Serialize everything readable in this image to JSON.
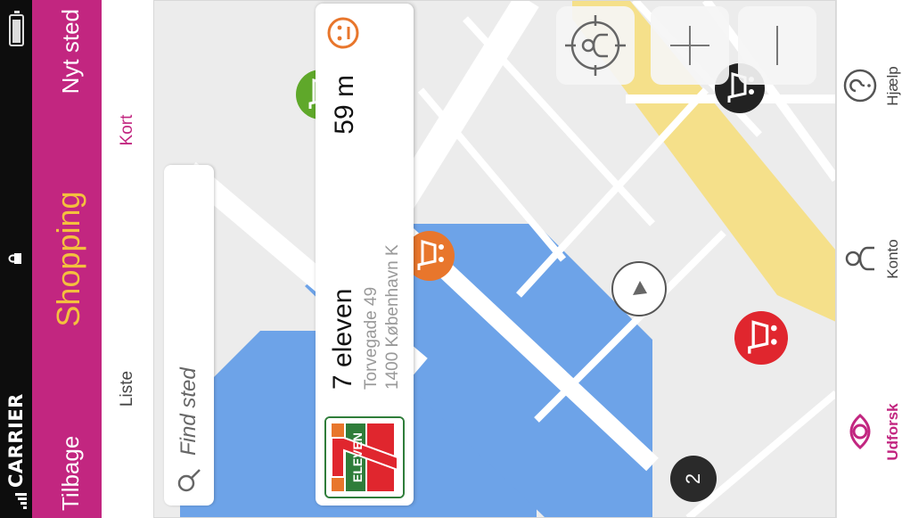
{
  "status": {
    "carrier": "CARRIER"
  },
  "nav": {
    "back": "Tilbage",
    "title": "Shopping",
    "new": "Nyt sted"
  },
  "tabs": [
    {
      "label": "Liste",
      "active": false
    },
    {
      "label": "Kort",
      "active": true
    }
  ],
  "search": {
    "placeholder": "Find sted"
  },
  "card": {
    "name": "7 eleven",
    "address_line1": "Torvegade 49",
    "address_line2": "1400 København K",
    "distance": "59 m",
    "logo_text": "ELEVEN",
    "logo_digit": "7"
  },
  "map": {
    "cluster_count": "2"
  },
  "bottom": [
    {
      "label": "Udforsk",
      "icon": "eye-icon",
      "active": true
    },
    {
      "label": "Konto",
      "icon": "person-icon",
      "active": false
    },
    {
      "label": "Hjælp",
      "icon": "question-icon",
      "active": false
    }
  ],
  "colors": {
    "brand": "#c22680",
    "title": "#f4c03e",
    "pin_green": "#5fa82a",
    "pin_orange": "#e8762c",
    "pin_red": "#e0262e",
    "pin_black": "#222222",
    "water": "#6da3e8",
    "road_major": "#f5e08a"
  }
}
